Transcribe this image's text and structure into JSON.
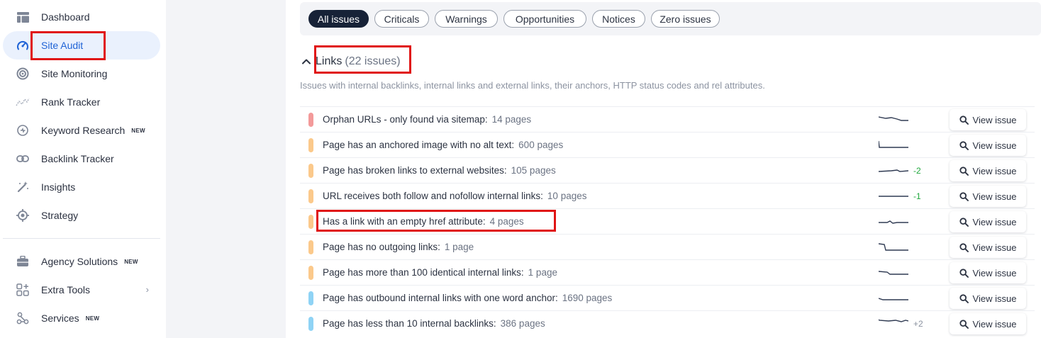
{
  "sidebar": {
    "items": [
      {
        "label": "Dashboard",
        "icon": "dashboard-icon"
      },
      {
        "label": "Site Audit",
        "icon": "gauge-icon",
        "active": true
      },
      {
        "label": "Site Monitoring",
        "icon": "monitoring-icon"
      },
      {
        "label": "Rank Tracker",
        "icon": "rank-tracker-icon"
      },
      {
        "label": "Keyword Research",
        "icon": "keyword-research-icon",
        "badge": "NEW"
      },
      {
        "label": "Backlink Tracker",
        "icon": "link-icon"
      },
      {
        "label": "Insights",
        "icon": "magic-wand-icon"
      },
      {
        "label": "Strategy",
        "icon": "target-icon"
      }
    ],
    "items_bottom": [
      {
        "label": "Agency Solutions",
        "icon": "briefcase-icon",
        "badge": "NEW"
      },
      {
        "label": "Extra Tools",
        "icon": "extra-tools-icon"
      },
      {
        "label": "Services",
        "icon": "services-icon",
        "badge": "NEW"
      }
    ]
  },
  "filters": [
    "All issues",
    "Criticals",
    "Warnings",
    "Opportunities",
    "Notices",
    "Zero issues"
  ],
  "active_filter": "All issues",
  "section": {
    "title": "Links",
    "count": "(22 issues)",
    "description": "Issues with internal backlinks, internal links and external links, their anchors, HTTP status codes and rel attributes."
  },
  "issues": [
    {
      "name": "Orphan URLs - only found via sitemap:",
      "pages": "14 pages",
      "severity": "critical",
      "delta": "",
      "button": "View issue"
    },
    {
      "name": "Page has an anchored image with no alt text:",
      "pages": "600 pages",
      "severity": "warning",
      "delta": "",
      "button": "View issue"
    },
    {
      "name": "Page has broken links to external websites:",
      "pages": "105 pages",
      "severity": "warning",
      "delta": "-2",
      "button": "View issue"
    },
    {
      "name": "URL receives both follow and nofollow internal links:",
      "pages": "10 pages",
      "severity": "warning",
      "delta": "-1",
      "button": "View issue"
    },
    {
      "name": "Has a link with an empty href attribute:",
      "pages": "4 pages",
      "severity": "warning",
      "delta": "",
      "button": "View issue"
    },
    {
      "name": "Page has no outgoing links:",
      "pages": "1 page",
      "severity": "warning",
      "delta": "",
      "button": "View issue"
    },
    {
      "name": "Page has more than 100 identical internal links:",
      "pages": "1 page",
      "severity": "warning",
      "delta": "",
      "button": "View issue"
    },
    {
      "name": "Page has outbound internal links with one word anchor:",
      "pages": "1690 pages",
      "severity": "notice",
      "delta": "",
      "button": "View issue"
    },
    {
      "name": "Page has less than 10 internal backlinks:",
      "pages": "386 pages",
      "severity": "notice",
      "delta": "+2",
      "button": "View issue"
    }
  ],
  "colors": {
    "critical": "#f39a9a",
    "warning": "#fbc98b",
    "notice": "#8fd3f5",
    "delta_down": "#1fa83c",
    "delta_up": "#8c93a1",
    "highlight": "#e01414",
    "active_nav": "#1f63d6"
  }
}
